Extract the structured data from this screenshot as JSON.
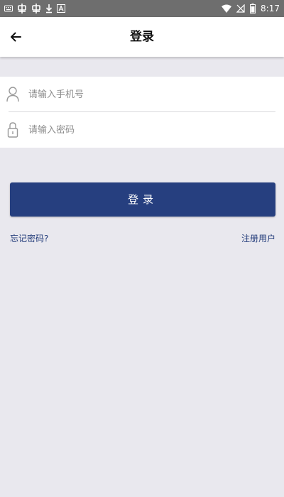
{
  "status_bar": {
    "time": "8:17",
    "left_icons": [
      "keyboard-icon",
      "bug-icon",
      "bug-icon",
      "download-icon",
      "text-a-icon"
    ],
    "right_icons": [
      "wifi-icon",
      "no-signal-icon",
      "battery-icon"
    ]
  },
  "app_bar": {
    "title": "登录",
    "back_icon": "arrow-left-icon"
  },
  "form": {
    "phone": {
      "placeholder": "请输入手机号",
      "value": "",
      "icon": "user-icon"
    },
    "password": {
      "placeholder": "请输入密码",
      "value": "",
      "icon": "lock-icon"
    }
  },
  "login_button": {
    "label": "登录"
  },
  "links": {
    "forgot_password": "忘记密码?",
    "register": "注册用户"
  },
  "colors": {
    "accent": "#263f7f",
    "link": "#243d7b",
    "background": "#e9e8ee",
    "status_bar": "#6e6e6e"
  }
}
